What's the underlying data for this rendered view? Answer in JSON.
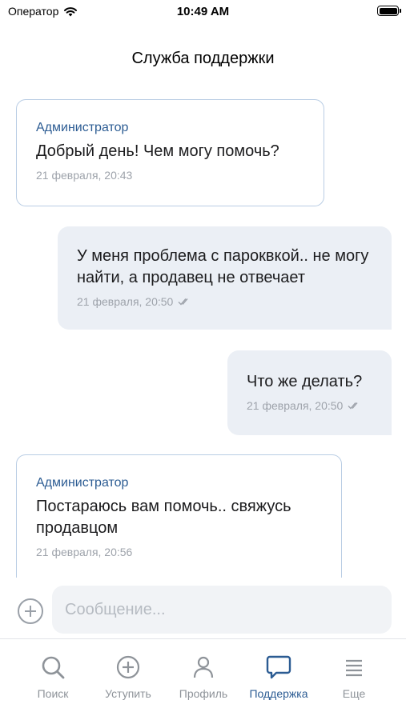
{
  "status_bar": {
    "carrier": "Оператор",
    "time": "10:49 AM",
    "icons": [
      "wifi-icon",
      "battery-icon"
    ]
  },
  "header": {
    "title": "Служба поддержки"
  },
  "messages": [
    {
      "direction": "incoming",
      "sender": "Администратор",
      "text": "Добрый день! Чем могу помочь?",
      "time": "21 февраля, 20:43"
    },
    {
      "direction": "outgoing",
      "text": "У меня проблема с пароквкой.. не могу найти, а продавец не отвечает",
      "time": "21 февраля, 20:50",
      "status_icon": "double-check-icon"
    },
    {
      "direction": "outgoing",
      "text": "Что же делать?",
      "time": "21 февраля, 20:50",
      "status_icon": "double-check-icon"
    },
    {
      "direction": "incoming",
      "sender": "Администратор",
      "text": "Постараюсь вам помочь.. свяжусь продавцом",
      "time": "21 февраля, 20:56"
    }
  ],
  "composer": {
    "placeholder": "Сообщение...",
    "value": "",
    "attach_icon": "plus-circle-icon"
  },
  "tabbar": {
    "items": [
      {
        "label": "Поиск",
        "icon": "search-icon",
        "active": false
      },
      {
        "label": "Уступить",
        "icon": "plus-circle-icon",
        "active": false
      },
      {
        "label": "Профиль",
        "icon": "person-icon",
        "active": false
      },
      {
        "label": "Поддержка",
        "icon": "chat-bubble-icon",
        "active": true
      },
      {
        "label": "Еще",
        "icon": "menu-icon",
        "active": false
      }
    ]
  },
  "colors": {
    "accent": "#2c5c93",
    "incoming_border": "#b9cde4",
    "outgoing_bg": "#ebeff5",
    "muted": "#9ea3ab",
    "inactive_tab": "#8e9399"
  }
}
